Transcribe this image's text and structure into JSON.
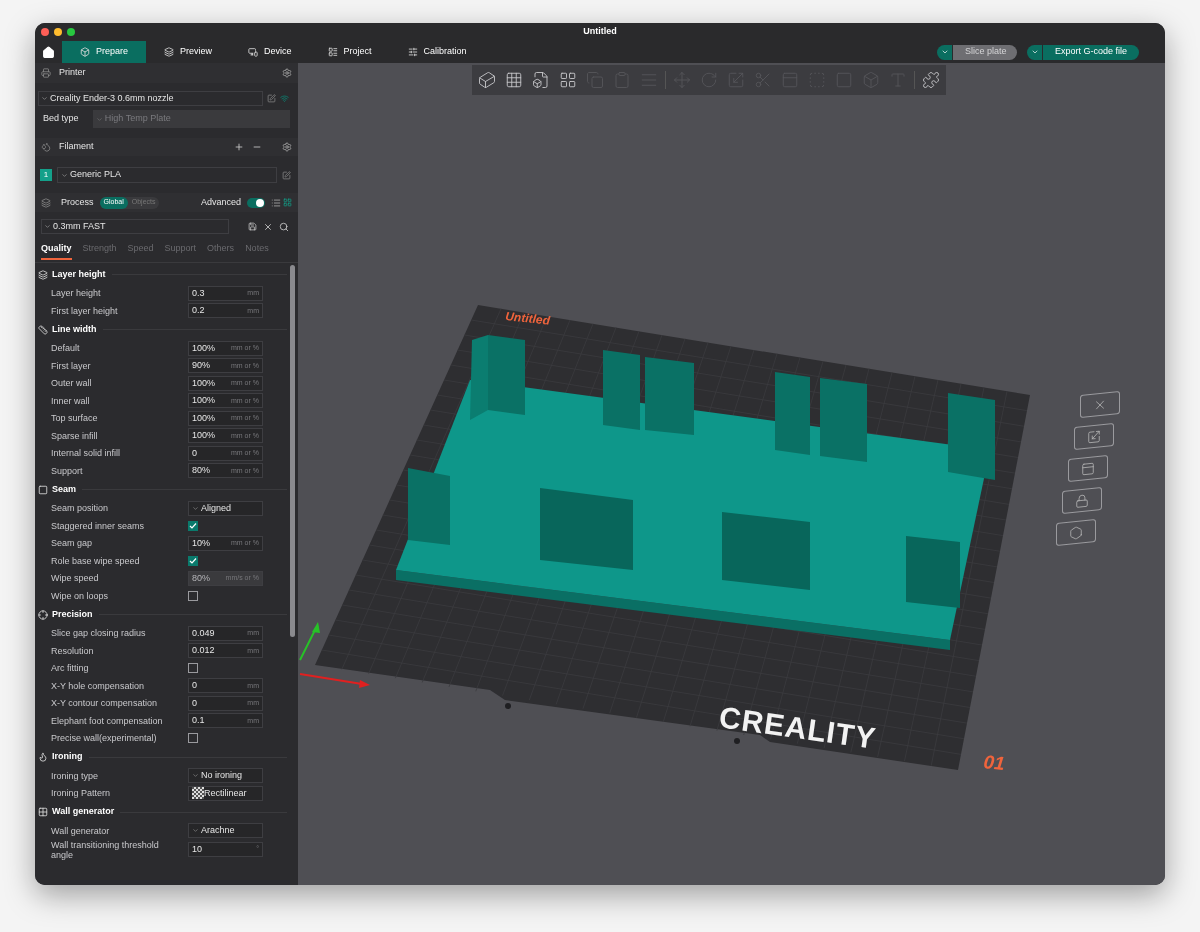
{
  "window": {
    "title": "Untitled"
  },
  "nav_tabs": [
    {
      "label": "Prepare",
      "selected": true
    },
    {
      "label": "Preview",
      "selected": false
    },
    {
      "label": "Device",
      "selected": false
    },
    {
      "label": "Project",
      "selected": false
    },
    {
      "label": "Calibration",
      "selected": false
    }
  ],
  "actions": [
    {
      "label": "Slice plate",
      "disabled": true
    },
    {
      "label": "Export G-code file",
      "disabled": false
    }
  ],
  "printer": {
    "title": "Printer",
    "preset": "Creality Ender-3 0.6mm nozzle",
    "bed_type_label": "Bed type",
    "bed_type": "High Temp Plate"
  },
  "filament": {
    "title": "Filament",
    "items": [
      {
        "index": "1",
        "name": "Generic PLA"
      }
    ]
  },
  "process": {
    "title": "Process",
    "scopes": [
      {
        "label": "Global",
        "selected": true
      },
      {
        "label": "Objects",
        "selected": false
      }
    ],
    "advanced_label": "Advanced",
    "advanced_on": true,
    "preset": "0.3mm FAST",
    "tabs": [
      {
        "label": "Quality",
        "selected": true
      },
      {
        "label": "Strength",
        "selected": false
      },
      {
        "label": "Speed",
        "selected": false
      },
      {
        "label": "Support",
        "selected": false
      },
      {
        "label": "Others",
        "selected": false
      },
      {
        "label": "Notes",
        "selected": false
      }
    ]
  },
  "groups": [
    {
      "title": "Layer height",
      "rows": [
        {
          "kind": "number",
          "label": "Layer height",
          "value": "0.3",
          "unit": "mm",
          "disabled": false
        },
        {
          "kind": "number",
          "label": "First layer height",
          "value": "0.2",
          "unit": "mm",
          "disabled": false
        }
      ]
    },
    {
      "title": "Line width",
      "rows": [
        {
          "kind": "number",
          "label": "Default",
          "value": "100%",
          "unit": "mm or %",
          "disabled": false
        },
        {
          "kind": "number",
          "label": "First layer",
          "value": "90%",
          "unit": "mm or %",
          "disabled": false
        },
        {
          "kind": "number",
          "label": "Outer wall",
          "value": "100%",
          "unit": "mm or %",
          "disabled": false
        },
        {
          "kind": "number",
          "label": "Inner wall",
          "value": "100%",
          "unit": "mm or %",
          "disabled": false
        },
        {
          "kind": "number",
          "label": "Top surface",
          "value": "100%",
          "unit": "mm or %",
          "disabled": false
        },
        {
          "kind": "number",
          "label": "Sparse infill",
          "value": "100%",
          "unit": "mm or %",
          "disabled": false
        },
        {
          "kind": "number",
          "label": "Internal solid infill",
          "value": "0",
          "unit": "mm or %",
          "disabled": false
        },
        {
          "kind": "number",
          "label": "Support",
          "value": "80%",
          "unit": "mm or %",
          "disabled": false
        }
      ]
    },
    {
      "title": "Seam",
      "rows": [
        {
          "kind": "select",
          "label": "Seam position",
          "value": "Aligned"
        },
        {
          "kind": "check",
          "label": "Staggered inner seams",
          "checked": true
        },
        {
          "kind": "number",
          "label": "Seam gap",
          "value": "10%",
          "unit": "mm or %",
          "disabled": false
        },
        {
          "kind": "check",
          "label": "Role base wipe speed",
          "checked": true
        },
        {
          "kind": "number",
          "label": "Wipe speed",
          "value": "80%",
          "unit": "mm/s or %",
          "disabled": true
        },
        {
          "kind": "check",
          "label": "Wipe on loops",
          "checked": false
        }
      ]
    },
    {
      "title": "Precision",
      "rows": [
        {
          "kind": "number",
          "label": "Slice gap closing radius",
          "value": "0.049",
          "unit": "mm",
          "disabled": false
        },
        {
          "kind": "number",
          "label": "Resolution",
          "value": "0.012",
          "unit": "mm",
          "disabled": false
        },
        {
          "kind": "check",
          "label": "Arc fitting",
          "checked": false
        },
        {
          "kind": "number",
          "label": "X-Y hole compensation",
          "value": "0",
          "unit": "mm",
          "disabled": false
        },
        {
          "kind": "number",
          "label": "X-Y contour compensation",
          "value": "0",
          "unit": "mm",
          "disabled": false
        },
        {
          "kind": "number",
          "label": "Elephant foot compensation",
          "value": "0.1",
          "unit": "mm",
          "disabled": false
        },
        {
          "kind": "check",
          "label": "Precise wall(experimental)",
          "checked": false
        }
      ]
    },
    {
      "title": "Ironing",
      "rows": [
        {
          "kind": "select",
          "label": "Ironing type",
          "value": "No ironing"
        },
        {
          "kind": "pattern",
          "label": "Ironing Pattern",
          "value": "Rectilinear"
        }
      ]
    },
    {
      "title": "Wall generator",
      "rows": [
        {
          "kind": "select",
          "label": "Wall generator",
          "value": "Arachne"
        },
        {
          "kind": "number",
          "label": "Wall transitioning threshold angle",
          "value": "10",
          "unit": "°",
          "disabled": false
        }
      ]
    }
  ],
  "toolbar": {
    "tools": [
      {
        "disabled": false
      },
      {
        "disabled": false
      },
      {
        "disabled": false
      },
      {
        "disabled": false
      },
      {
        "disabled": true
      },
      {
        "disabled": true
      },
      {
        "disabled": true
      },
      {
        "disabled": true
      },
      {
        "disabled": true
      },
      {
        "disabled": true
      },
      {
        "disabled": true
      },
      {
        "disabled": true
      },
      {
        "disabled": true
      },
      {
        "disabled": true
      },
      {
        "disabled": true
      },
      {
        "disabled": true
      },
      {
        "disabled": false
      }
    ]
  },
  "viewport": {
    "plate_name": "Untitled",
    "bed_logo": "CREALITY",
    "bed_number": "01"
  }
}
